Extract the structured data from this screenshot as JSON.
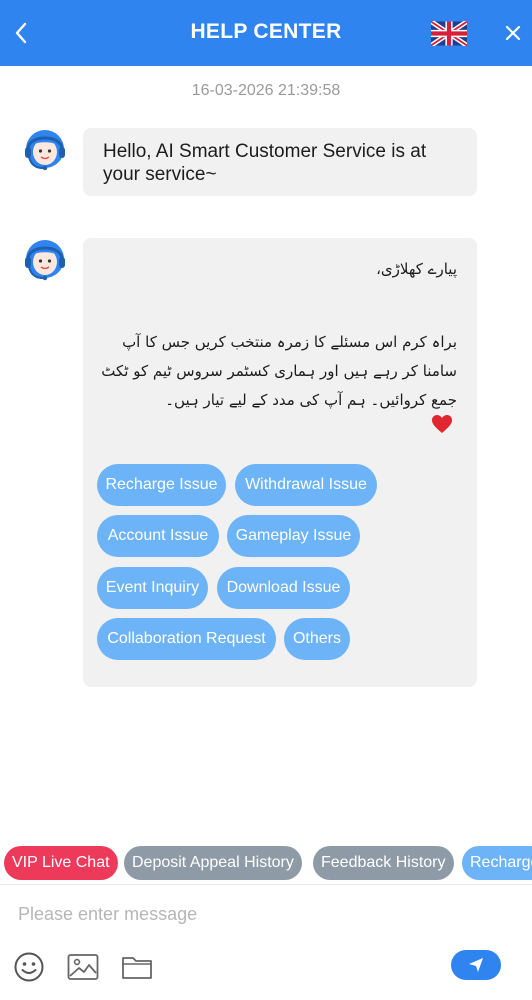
{
  "header": {
    "title": "HELP CENTER",
    "back_icon": "chevron-left-icon",
    "language_icon": "uk-flag-icon",
    "close_icon": "close-icon"
  },
  "chat": {
    "timestamp": "16-03-2026 21:39:58",
    "messages": [
      {
        "text": "Hello, AI Smart Customer Service is at your service~"
      },
      {
        "greeting": "پیارے کھلاڑی،",
        "body": "براہ کرم اس مسئلے کا زمرہ منتخب کریں جس کا آپ سامنا کر رہے ہیں اور ہماری کسٹمر سروس ٹیم کو ٹکٹ جمع کروائیں۔ ہم آپ کی مدد کے لیے تیار ہیں۔",
        "emoji": "heart-icon"
      }
    ],
    "categories": [
      "Recharge Issue",
      "Withdrawal Issue",
      "Account Issue",
      "Gameplay Issue",
      "Event Inquiry",
      "Download Issue",
      "Collaboration Request",
      "Others"
    ]
  },
  "quick_actions": [
    "VIP Live Chat",
    "Deposit Appeal History",
    "Feedback History",
    "Recharge"
  ],
  "composer": {
    "placeholder": "Please enter message",
    "tools": [
      "emoji-icon",
      "image-icon",
      "folder-icon"
    ],
    "send_icon": "send-icon"
  },
  "colors": {
    "primary": "#2f84f0",
    "chip": "#6cb3f7",
    "vip": "#ee3a5a",
    "history": "#8e9ba6",
    "bubble": "#f1f1f1"
  }
}
